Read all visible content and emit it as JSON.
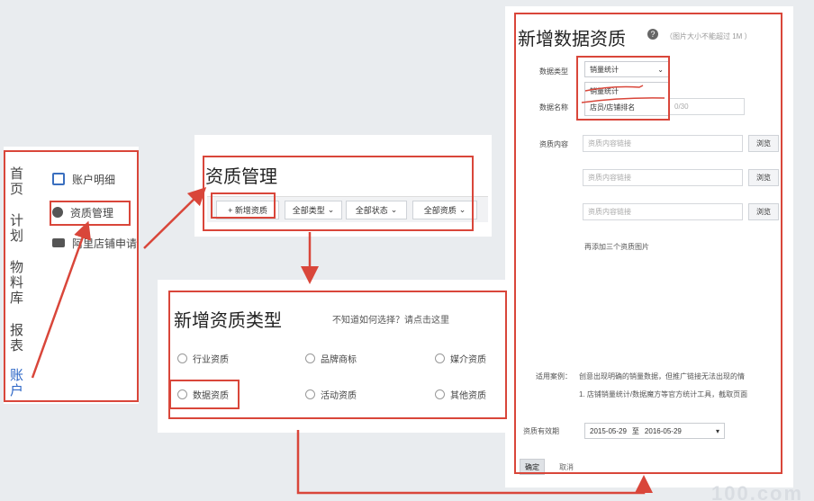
{
  "colors": {
    "annotation_red": "#d9463a",
    "page_bg": "#e9ecef"
  },
  "left_nav": {
    "main_items": [
      {
        "label": "首页",
        "chars": [
          "首",
          "页"
        ]
      },
      {
        "label": "计划",
        "chars": [
          "计",
          "划"
        ]
      },
      {
        "label": "物料库",
        "chars": [
          "物",
          "料",
          "库"
        ]
      },
      {
        "label": "报表",
        "chars": [
          "报",
          "表"
        ]
      },
      {
        "label": "账户",
        "chars": [
          "账",
          "户"
        ]
      }
    ],
    "sub_items": [
      {
        "label": "账户明细",
        "icon": "clipboard-icon"
      },
      {
        "label": "资质管理",
        "icon": "user-badge-icon"
      },
      {
        "label": "阿里店铺申请",
        "icon": "store-icon"
      }
    ]
  },
  "qualification_manage": {
    "title": "资质管理",
    "add_button": "+ 新增资质",
    "filters": [
      "全部类型",
      "全部状态",
      "全部资质"
    ]
  },
  "add_type": {
    "title": "新增资质类型",
    "hint": "不知道如何选择？请点击这里",
    "options": [
      {
        "label": "行业资质"
      },
      {
        "label": "品牌商标"
      },
      {
        "label": "媒介资质"
      },
      {
        "label": "数据资质"
      },
      {
        "label": "活动资质"
      },
      {
        "label": "其他资质"
      }
    ]
  },
  "add_data": {
    "title": "新增数据资质",
    "help_icon": "?",
    "note": "（图片大小不能超过 1M ）",
    "data_type_label": "数据类型",
    "data_type_value": "销量统计",
    "dropdown_options": [
      "销量统计",
      "店员/店铺排名"
    ],
    "data_name_label": "数据名称",
    "data_name_placeholder": "0/30",
    "content_label": "资质内容",
    "content_placeholder": "资质内容链接",
    "browse_label": "浏览",
    "add_more": "再添加三个资质图片",
    "usage_label": "适用案例：",
    "usage_text_1": "创意出现明确的销量数据，但推广链接无法出现的情",
    "usage_text_2": "1. 店铺销量统计/数据魔方等官方统计工具，截取页面",
    "validity_label": "资质有效期",
    "date_start": "2015-05-29",
    "date_sep": "至",
    "date_end": "2016-05-29",
    "ok": "确定",
    "cancel": "取消"
  },
  "watermark": "100.com"
}
